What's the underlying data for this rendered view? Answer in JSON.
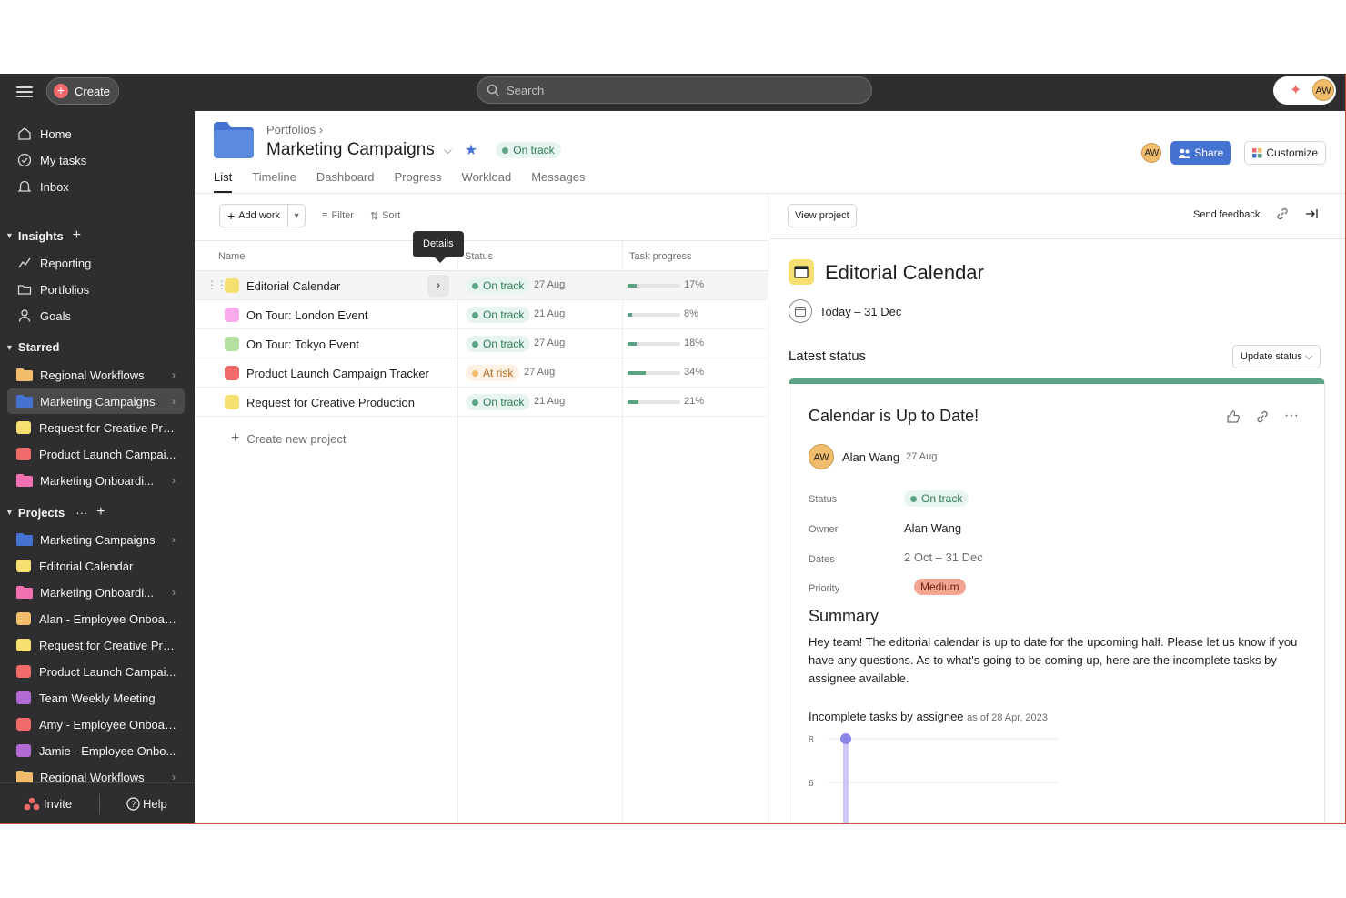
{
  "topbar": {
    "create_label": "Create",
    "search_placeholder": "Search",
    "user_initials": "AW"
  },
  "sidebar": {
    "nav": [
      {
        "label": "Home",
        "icon": "home-icon"
      },
      {
        "label": "My tasks",
        "icon": "check-circle-icon"
      },
      {
        "label": "Inbox",
        "icon": "bell-icon"
      }
    ],
    "insights_label": "Insights",
    "insights": [
      {
        "label": "Reporting",
        "icon": "chart-line-icon"
      },
      {
        "label": "Portfolios",
        "icon": "folder-icon"
      },
      {
        "label": "Goals",
        "icon": "person-icon"
      }
    ],
    "starred_label": "Starred",
    "starred": [
      {
        "label": "Regional Workflows",
        "color": "#f1bd6c",
        "kind": "folder",
        "chevron": true
      },
      {
        "label": "Marketing Campaigns",
        "color": "#4573d2",
        "kind": "folder",
        "chevron": true,
        "active": true
      },
      {
        "label": "Request for Creative Pro...",
        "color": "#f8df72",
        "kind": "project"
      },
      {
        "label": "Product Launch Campai...",
        "color": "#f06a6a",
        "kind": "project"
      },
      {
        "label": "Marketing Onboardi...",
        "color": "#f26fb2",
        "kind": "folder",
        "chevron": true
      }
    ],
    "projects_label": "Projects",
    "projects_more": "···",
    "projects": [
      {
        "label": "Marketing Campaigns",
        "color": "#4573d2",
        "kind": "folder",
        "chevron": true
      },
      {
        "label": "Editorial Calendar",
        "color": "#f8df72",
        "kind": "project"
      },
      {
        "label": "Marketing Onboardi...",
        "color": "#f26fb2",
        "kind": "folder",
        "chevron": true
      },
      {
        "label": "Alan - Employee Onboar...",
        "color": "#f1bd6c",
        "kind": "project"
      },
      {
        "label": "Request for Creative Pro...",
        "color": "#f8df72",
        "kind": "project"
      },
      {
        "label": "Product Launch Campai...",
        "color": "#f06a6a",
        "kind": "project"
      },
      {
        "label": "Team Weekly Meeting",
        "color": "#b36bd4",
        "kind": "project"
      },
      {
        "label": "Amy - Employee Onboar...",
        "color": "#f06a6a",
        "kind": "project"
      },
      {
        "label": "Jamie - Employee Onbo...",
        "color": "#b36bd4",
        "kind": "project"
      },
      {
        "label": "Regional Workflows",
        "color": "#f1bd6c",
        "kind": "folder",
        "chevron": true
      }
    ],
    "invite_label": "Invite",
    "help_label": "Help"
  },
  "header": {
    "breadcrumb": "Portfolios",
    "title": "Marketing Campaigns",
    "status": "On track",
    "tabs": [
      "List",
      "Timeline",
      "Dashboard",
      "Progress",
      "Workload",
      "Messages"
    ],
    "active_tab": "List",
    "share_label": "Share",
    "customize_label": "Customize",
    "avatar_initials": "AW"
  },
  "list": {
    "add_work_label": "Add work",
    "filter_label": "Filter",
    "sort_label": "Sort",
    "columns": {
      "name": "Name",
      "status": "Status",
      "progress": "Task progress"
    },
    "tooltip": "Details",
    "rows": [
      {
        "name": "Editorial Calendar",
        "status": "On track",
        "status_kind": "green",
        "date": "27 Aug",
        "progress": 17,
        "pct": "17%",
        "color": "#f8df72"
      },
      {
        "name": "On Tour: London Event",
        "status": "On track",
        "status_kind": "green",
        "date": "21 Aug",
        "progress": 8,
        "pct": "8%",
        "color": "#f9aaef"
      },
      {
        "name": "On Tour: Tokyo Event",
        "status": "On track",
        "status_kind": "green",
        "date": "27 Aug",
        "progress": 18,
        "pct": "18%",
        "color": "#b3dfa0"
      },
      {
        "name": "Product Launch Campaign Tracker",
        "status": "At risk",
        "status_kind": "orange",
        "date": "27 Aug",
        "progress": 34,
        "pct": "34%",
        "color": "#f06a6a"
      },
      {
        "name": "Request for Creative Production",
        "status": "On track",
        "status_kind": "green",
        "date": "21 Aug",
        "progress": 21,
        "pct": "21%",
        "color": "#f8df72"
      }
    ],
    "create_new_label": "Create new project"
  },
  "detail": {
    "view_project_label": "View project",
    "send_feedback_label": "Send feedback",
    "title": "Editorial Calendar",
    "dates": "Today – 31 Dec",
    "latest_status_label": "Latest status",
    "update_status_label": "Update status",
    "card": {
      "title": "Calendar is Up to Date!",
      "author": "Alan Wang",
      "author_initials": "AW",
      "date": "27 Aug",
      "fields": {
        "status_label": "Status",
        "status": "On track",
        "owner_label": "Owner",
        "owner": "Alan Wang",
        "dates_label": "Dates",
        "dates": "2 Oct – 31 Dec",
        "priority_label": "Priority",
        "priority": "Medium"
      },
      "summary_label": "Summary",
      "summary": "Hey team! The editorial calendar is up to date for the upcoming half. Please let us know if you have any questions. As to what's going to be coming up, here are the incomplete tasks by assignee available.",
      "chart_title": "Incomplete tasks by assignee",
      "chart_subtitle": "as of 28 Apr, 2023",
      "chart_ticks": [
        "8",
        "6"
      ]
    }
  },
  "chart_data": {
    "type": "bar",
    "title": "Incomplete tasks by assignee",
    "subtitle": "as of 28 Apr, 2023",
    "y_ticks": [
      8,
      6
    ],
    "series": [
      {
        "values": [
          8
        ]
      }
    ],
    "grid": true
  }
}
